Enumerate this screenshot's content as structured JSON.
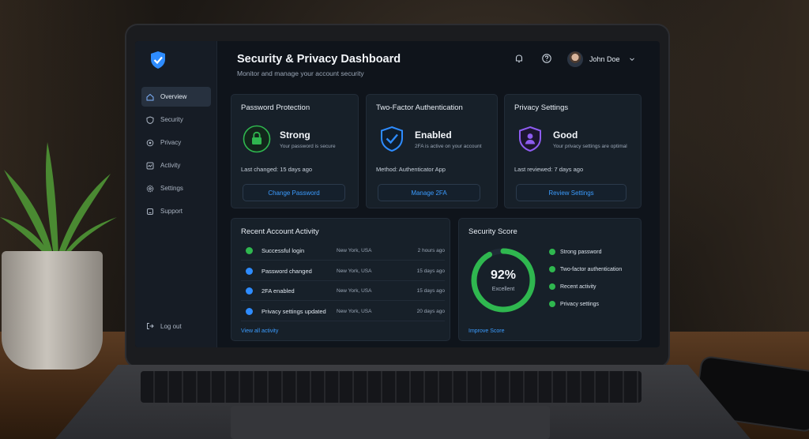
{
  "app": {
    "title": "Security & Privacy Dashboard",
    "subtitle": "Monitor and manage your account security"
  },
  "sidebar": {
    "items": [
      {
        "label": "Overview",
        "icon": "home-icon",
        "active": true
      },
      {
        "label": "Security",
        "icon": "shield-icon",
        "active": false
      },
      {
        "label": "Privacy",
        "icon": "eye-icon",
        "active": false
      },
      {
        "label": "Activity",
        "icon": "activity-icon",
        "active": false
      },
      {
        "label": "Settings",
        "icon": "gear-icon",
        "active": false
      },
      {
        "label": "Support",
        "icon": "support-icon",
        "active": false
      }
    ],
    "logout_label": "Log out"
  },
  "header": {
    "user_name": "John Doe",
    "icons": [
      "bell-icon",
      "help-icon",
      "chevron-down-icon"
    ]
  },
  "cards": {
    "password": {
      "title": "Password Protection",
      "status": "Strong",
      "description": "Your password is secure",
      "meta": "Last changed: 15 days ago",
      "button": "Change Password",
      "color": "#2fb74f"
    },
    "twofa": {
      "title": "Two-Factor Authentication",
      "status": "Enabled",
      "description": "2FA is active on your account",
      "meta": "Method: Authenticator App",
      "button": "Manage 2FA",
      "color": "#2e8cff"
    },
    "privacy": {
      "title": "Privacy Settings",
      "status": "Good",
      "description": "Your privacy settings are optimal",
      "meta": "Last reviewed: 7 days ago",
      "button": "Review Settings",
      "color": "#8e5cf0"
    }
  },
  "activity": {
    "title": "Recent Account Activity",
    "rows": [
      {
        "event": "Successful login",
        "location": "New York, USA",
        "time": "2 hours ago",
        "status_color": "#2fb74f"
      },
      {
        "event": "Password changed",
        "location": "New York, USA",
        "time": "15 days ago",
        "status_color": "#2e8cff"
      },
      {
        "event": "2FA enabled",
        "location": "New York, USA",
        "time": "15 days ago",
        "status_color": "#2e8cff"
      },
      {
        "event": "Privacy settings updated",
        "location": "New York, USA",
        "time": "20 days ago",
        "status_color": "#2e8cff"
      }
    ],
    "link": "View all activity"
  },
  "score": {
    "title": "Security Score",
    "value": "92%",
    "percent": 92,
    "label": "Excellent",
    "checks": [
      "Strong password",
      "Two-factor authentication",
      "Recent activity",
      "Privacy settings"
    ],
    "link": "Improve Score",
    "color": "#2fb74f"
  }
}
